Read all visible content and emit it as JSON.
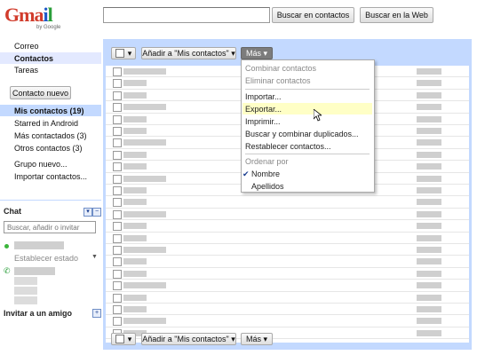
{
  "logo": {
    "text": "Gmail",
    "by": "by Google"
  },
  "search": {
    "placeholder": "",
    "btn_contacts": "Buscar en contactos",
    "btn_web": "Buscar en la Web"
  },
  "nav": {
    "correo": "Correo",
    "contactos": "Contactos",
    "tareas": "Tareas"
  },
  "new_contact": "Contacto nuevo",
  "groups": [
    "Mis contactos (19)",
    "Starred in Android",
    "Más contactados (3)",
    "Otros contactos (3)"
  ],
  "new_group": "Grupo nuevo...",
  "import_contacts": "Importar contactos...",
  "chat": {
    "title": "Chat",
    "search_placeholder": "Buscar, añadir o invitar",
    "set_status": "Establecer estado",
    "invite": "Invitar a un amigo"
  },
  "toolbar": {
    "add_to": "Añadir a \"Mis contactos\"",
    "more": "Más"
  },
  "menu": {
    "items_disabled": [
      "Combinar contactos",
      "Eliminar contactos"
    ],
    "items": [
      "Importar...",
      "Exportar...",
      "Imprimir...",
      "Buscar y combinar duplicados...",
      "Restablecer contactos..."
    ],
    "sort_header": "Ordenar por",
    "sort_options": [
      "Nombre",
      "Apellidos"
    ]
  },
  "colors": {
    "panel": "#c3d9ff",
    "highlight": "#ffffc6",
    "selected": "#c3d9ff"
  }
}
